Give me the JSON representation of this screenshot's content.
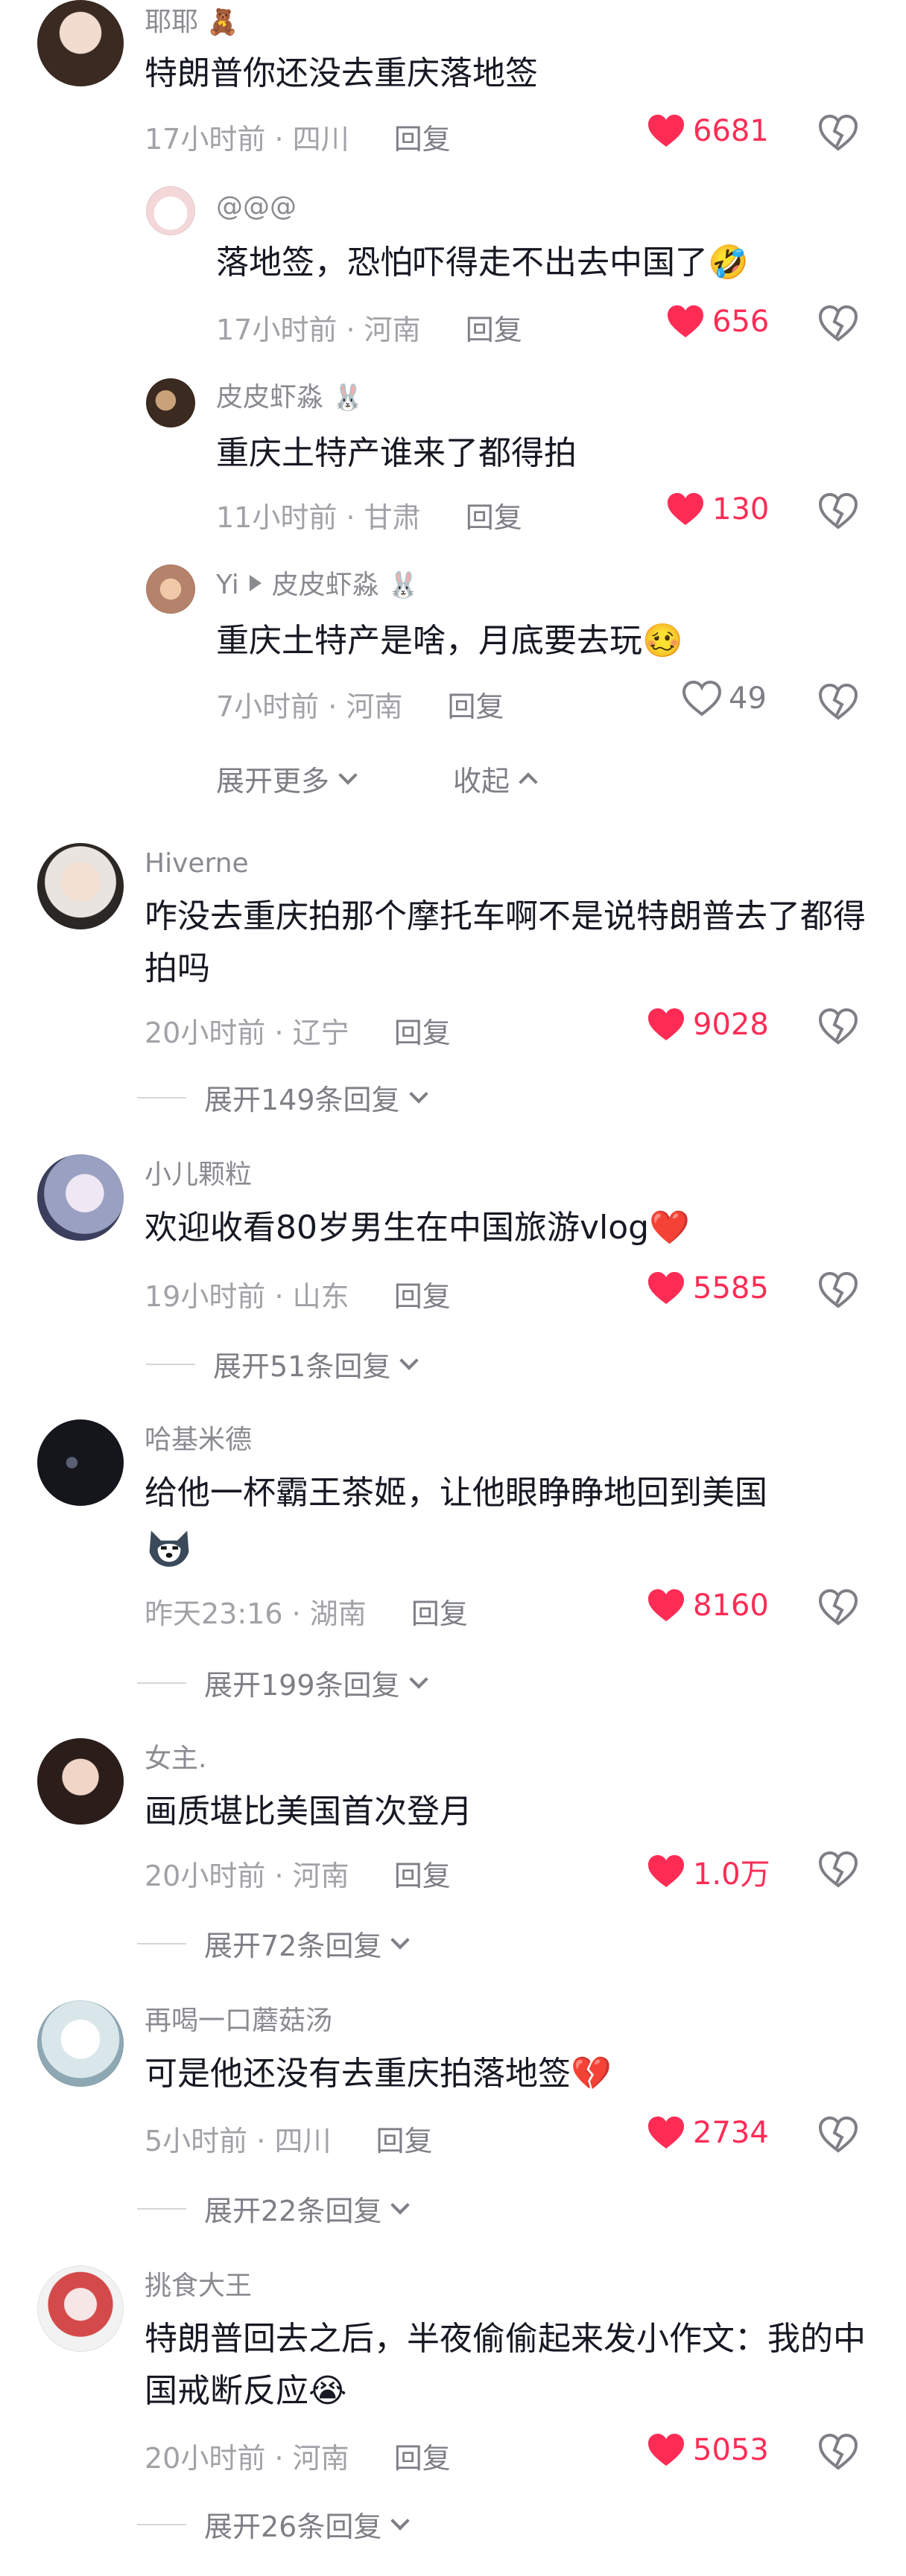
{
  "comments": [
    {
      "name": "耶耶",
      "name_emoji": "🧸",
      "text": "特朗普你还没去重庆落地签",
      "time": "17小时前",
      "location": "四川",
      "reply_label": "回复",
      "likes": "6681",
      "liked": true,
      "replies": [
        {
          "name": "@@@",
          "text": "落地签，恐怕吓得走不出去中国了",
          "text_emoji": "🤣",
          "time": "17小时前",
          "location": "河南",
          "reply_label": "回复",
          "likes": "656",
          "liked": true
        },
        {
          "name": "皮皮虾淼",
          "name_emoji": "🐰",
          "text": "重庆土特产谁来了都得拍",
          "time": "11小时前",
          "location": "甘肃",
          "reply_label": "回复",
          "likes": "130",
          "liked": true
        },
        {
          "name": "Yi",
          "reply_to": "皮皮虾淼",
          "reply_to_emoji": "🐰",
          "text": "重庆土特产是啥，月底要去玩",
          "text_emoji": "🥴",
          "time": "7小时前",
          "location": "河南",
          "reply_label": "回复",
          "likes": "49",
          "liked": false
        }
      ],
      "show_more_label": "展开更多",
      "collapse_label": "收起"
    },
    {
      "name": "Hiverne",
      "text": "咋没去重庆拍那个摩托车啊不是说特朗普去了都得拍吗",
      "time": "20小时前",
      "location": "辽宁",
      "reply_label": "回复",
      "likes": "9028",
      "liked": true,
      "expand_label": "展开149条回复"
    },
    {
      "name": "小儿颗粒",
      "text": "欢迎收看80岁男生在中国旅游vlog",
      "text_emoji": "❤️",
      "time": "19小时前",
      "location": "山东",
      "reply_label": "回复",
      "likes": "5585",
      "liked": true,
      "expand_label": "展开51条回复"
    },
    {
      "name": "哈基米德",
      "text": "给他一杯霸王茶姬，让他眼睁睁地回到美国",
      "text_emoji": "husky",
      "time": "昨天23:16",
      "location": "湖南",
      "reply_label": "回复",
      "likes": "8160",
      "liked": true,
      "expand_label": "展开199条回复"
    },
    {
      "name": "女主.",
      "text": "画质堪比美国首次登月",
      "time": "20小时前",
      "location": "河南",
      "reply_label": "回复",
      "likes": "1.0万",
      "liked": true,
      "expand_label": "展开72条回复"
    },
    {
      "name": "再喝一口蘑菇汤",
      "text": "可是他还没有去重庆拍落地签",
      "text_emoji": "💔",
      "time": "5小时前",
      "location": "四川",
      "reply_label": "回复",
      "likes": "2734",
      "liked": true,
      "expand_label": "展开22条回复"
    },
    {
      "name": "挑食大王",
      "text": "特朗普回去之后，半夜偷偷起来发小作文：我的中国戒断反应",
      "text_emoji": "😭",
      "time": "20小时前",
      "location": "河南",
      "reply_label": "回复",
      "likes": "5053",
      "liked": true,
      "expand_label": "展开26条回复"
    }
  ],
  "colors": {
    "like_red": "#fe2c55",
    "meta_grey": "#a1a2a7",
    "text_dark": "#161823"
  }
}
